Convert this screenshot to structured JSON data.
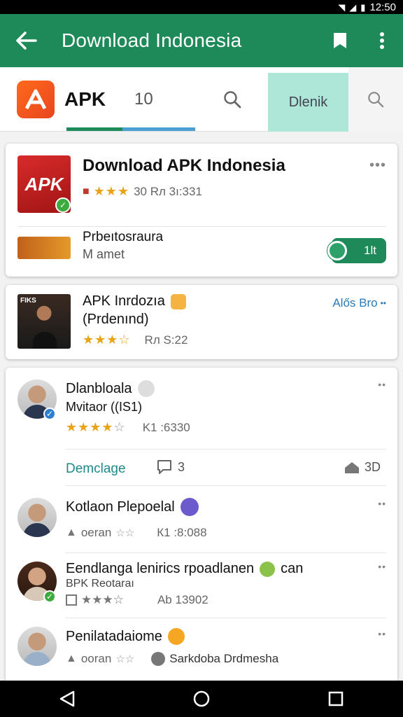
{
  "status": {
    "time": "12:50"
  },
  "appbar": {
    "title": "Download Indonesia"
  },
  "tabs": {
    "brand": "APK",
    "count": "10",
    "active_label": "Dlenik"
  },
  "card1": {
    "title": "Download APK Indonesia",
    "meta": "30 Rл 3ı:331",
    "icon_label": "APK",
    "sub_title": "Prbeıtosraura",
    "sub_meta": "M amet",
    "toggle_label": "1lt"
  },
  "card2": {
    "title": "APK Inrdozıa",
    "subtitle": "(Prdenınd)",
    "meta": "Rл S:22",
    "action": "Alős Bro",
    "thumb_label": "FIKS"
  },
  "card3": {
    "post1": {
      "name": "Dlanbloala",
      "sub": "Mvitaor ((IS1)",
      "meta": "K1 :6330"
    },
    "actions": {
      "download": "Demclage",
      "comments": "3",
      "shares": "3D"
    },
    "post2": {
      "name": "Kotlaon Plepoelal",
      "meta1": "oeran",
      "meta2": "К1 :8:088"
    },
    "post3": {
      "name": "Eendlanga lenirics  rpoadlanen",
      "suffix": "can",
      "sub": "BPK Reotaraı",
      "meta": "Ab 13902"
    },
    "post4": {
      "name": "Penilatadaiome",
      "meta1": "ooran",
      "meta2": "Sarkdoba Drdmesha"
    }
  },
  "colors": {
    "appbar": "#1e8a5a",
    "accent": "#1e8a5a",
    "star": "#e8a317",
    "tab_active": "#aee6d8"
  }
}
